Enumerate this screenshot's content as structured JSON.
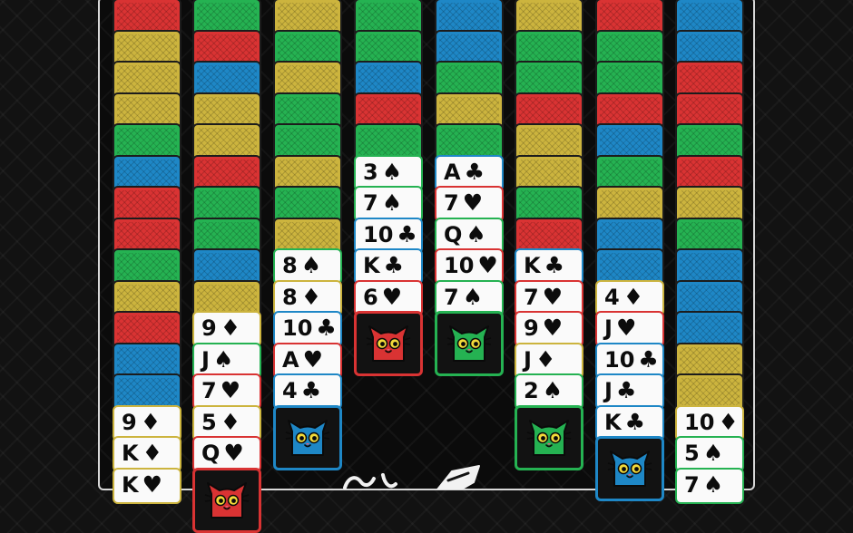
{
  "game": {
    "columns": [
      {
        "backs": [
          "red",
          "yellow",
          "yellow",
          "yellow",
          "green",
          "blue",
          "red",
          "red",
          "green",
          "yellow",
          "red",
          "blue",
          "blue"
        ],
        "faces": [
          {
            "rank": "9",
            "suit": "♦",
            "border": "yellow"
          },
          {
            "rank": "K",
            "suit": "♦",
            "border": "yellow"
          },
          {
            "rank": "K",
            "suit": "♥",
            "border": "yellow"
          }
        ],
        "cat": null
      },
      {
        "backs": [
          "green",
          "red",
          "blue",
          "yellow",
          "yellow",
          "red",
          "green",
          "green",
          "blue",
          "yellow"
        ],
        "faces": [
          {
            "rank": "9",
            "suit": "♦",
            "border": "yellow"
          },
          {
            "rank": "J",
            "suit": "♠",
            "border": "green"
          },
          {
            "rank": "7",
            "suit": "♥",
            "border": "red"
          },
          {
            "rank": "5",
            "suit": "♦",
            "border": "yellow"
          },
          {
            "rank": "Q",
            "suit": "♥",
            "border": "red"
          }
        ],
        "cat": {
          "color": "red"
        }
      },
      {
        "backs": [
          "yellow",
          "green",
          "yellow",
          "green",
          "green",
          "yellow",
          "green",
          "yellow"
        ],
        "faces": [
          {
            "rank": "8",
            "suit": "♠",
            "border": "green"
          },
          {
            "rank": "8",
            "suit": "♦",
            "border": "yellow"
          },
          {
            "rank": "10",
            "suit": "♣",
            "border": "blue"
          },
          {
            "rank": "A",
            "suit": "♥",
            "border": "red"
          },
          {
            "rank": "4",
            "suit": "♣",
            "border": "blue"
          }
        ],
        "cat": {
          "color": "blue"
        }
      },
      {
        "backs": [
          "green",
          "green",
          "blue",
          "red",
          "green"
        ],
        "faces": [
          {
            "rank": "3",
            "suit": "♠",
            "border": "green"
          },
          {
            "rank": "7",
            "suit": "♠",
            "border": "green"
          },
          {
            "rank": "10",
            "suit": "♣",
            "border": "blue"
          },
          {
            "rank": "K",
            "suit": "♣",
            "border": "blue"
          },
          {
            "rank": "6",
            "suit": "♥",
            "border": "red"
          }
        ],
        "cat": {
          "color": "red"
        }
      },
      {
        "backs": [
          "blue",
          "blue",
          "green",
          "yellow",
          "green"
        ],
        "faces": [
          {
            "rank": "A",
            "suit": "♣",
            "border": "blue"
          },
          {
            "rank": "7",
            "suit": "♥",
            "border": "red"
          },
          {
            "rank": "Q",
            "suit": "♠",
            "border": "green"
          },
          {
            "rank": "10",
            "suit": "♥",
            "border": "red"
          },
          {
            "rank": "7",
            "suit": "♠",
            "border": "green"
          }
        ],
        "cat": {
          "color": "green"
        }
      },
      {
        "backs": [
          "yellow",
          "green",
          "green",
          "red",
          "yellow",
          "yellow",
          "green",
          "red"
        ],
        "faces": [
          {
            "rank": "K",
            "suit": "♣",
            "border": "blue"
          },
          {
            "rank": "7",
            "suit": "♥",
            "border": "red"
          },
          {
            "rank": "9",
            "suit": "♥",
            "border": "red"
          },
          {
            "rank": "J",
            "suit": "♦",
            "border": "yellow"
          },
          {
            "rank": "2",
            "suit": "♠",
            "border": "green"
          }
        ],
        "cat": {
          "color": "green"
        }
      },
      {
        "backs": [
          "red",
          "green",
          "green",
          "red",
          "blue",
          "green",
          "yellow",
          "blue",
          "blue"
        ],
        "faces": [
          {
            "rank": "4",
            "suit": "♦",
            "border": "yellow"
          },
          {
            "rank": "J",
            "suit": "♥",
            "border": "red"
          },
          {
            "rank": "10",
            "suit": "♣",
            "border": "blue"
          },
          {
            "rank": "J",
            "suit": "♣",
            "border": "blue"
          },
          {
            "rank": "K",
            "suit": "♣",
            "border": "blue"
          }
        ],
        "cat": {
          "color": "blue"
        }
      },
      {
        "backs": [
          "blue",
          "blue",
          "red",
          "red",
          "green",
          "red",
          "yellow",
          "green",
          "blue",
          "blue",
          "blue",
          "yellow",
          "yellow"
        ],
        "faces": [
          {
            "rank": "10",
            "suit": "♦",
            "border": "yellow"
          },
          {
            "rank": "5",
            "suit": "♠",
            "border": "green"
          },
          {
            "rank": "7",
            "suit": "♠",
            "border": "green"
          }
        ],
        "cat": null
      }
    ]
  },
  "colors": {
    "red": "#d93333",
    "yellow": "#ccb43e",
    "green": "#25b252",
    "blue": "#1e87c6"
  },
  "icons": {
    "cat": "cat-face-icon",
    "logo": "game-logo"
  }
}
